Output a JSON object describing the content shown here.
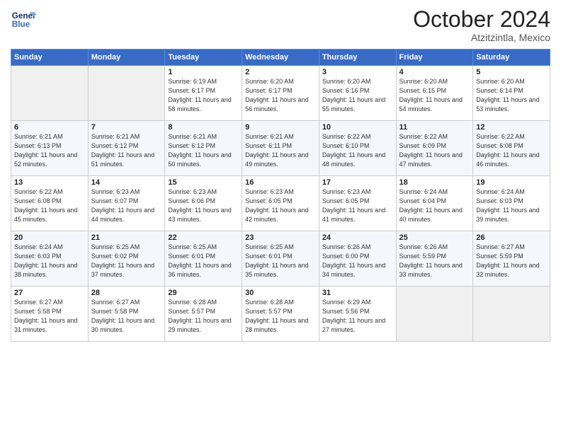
{
  "header": {
    "logo_line1": "General",
    "logo_line2": "Blue",
    "month": "October 2024",
    "location": "Atzitzintla, Mexico"
  },
  "days_of_week": [
    "Sunday",
    "Monday",
    "Tuesday",
    "Wednesday",
    "Thursday",
    "Friday",
    "Saturday"
  ],
  "weeks": [
    [
      {
        "day": "",
        "info": ""
      },
      {
        "day": "",
        "info": ""
      },
      {
        "day": "1",
        "info": "Sunrise: 6:19 AM\nSunset: 6:17 PM\nDaylight: 11 hours and 58 minutes."
      },
      {
        "day": "2",
        "info": "Sunrise: 6:20 AM\nSunset: 6:17 PM\nDaylight: 11 hours and 56 minutes."
      },
      {
        "day": "3",
        "info": "Sunrise: 6:20 AM\nSunset: 6:16 PM\nDaylight: 11 hours and 55 minutes."
      },
      {
        "day": "4",
        "info": "Sunrise: 6:20 AM\nSunset: 6:15 PM\nDaylight: 11 hours and 54 minutes."
      },
      {
        "day": "5",
        "info": "Sunrise: 6:20 AM\nSunset: 6:14 PM\nDaylight: 11 hours and 53 minutes."
      }
    ],
    [
      {
        "day": "6",
        "info": "Sunrise: 6:21 AM\nSunset: 6:13 PM\nDaylight: 11 hours and 52 minutes."
      },
      {
        "day": "7",
        "info": "Sunrise: 6:21 AM\nSunset: 6:12 PM\nDaylight: 11 hours and 51 minutes."
      },
      {
        "day": "8",
        "info": "Sunrise: 6:21 AM\nSunset: 6:12 PM\nDaylight: 11 hours and 50 minutes."
      },
      {
        "day": "9",
        "info": "Sunrise: 6:21 AM\nSunset: 6:11 PM\nDaylight: 11 hours and 49 minutes."
      },
      {
        "day": "10",
        "info": "Sunrise: 6:22 AM\nSunset: 6:10 PM\nDaylight: 11 hours and 48 minutes."
      },
      {
        "day": "11",
        "info": "Sunrise: 6:22 AM\nSunset: 6:09 PM\nDaylight: 11 hours and 47 minutes."
      },
      {
        "day": "12",
        "info": "Sunrise: 6:22 AM\nSunset: 6:08 PM\nDaylight: 11 hours and 46 minutes."
      }
    ],
    [
      {
        "day": "13",
        "info": "Sunrise: 6:22 AM\nSunset: 6:08 PM\nDaylight: 11 hours and 45 minutes."
      },
      {
        "day": "14",
        "info": "Sunrise: 6:23 AM\nSunset: 6:07 PM\nDaylight: 11 hours and 44 minutes."
      },
      {
        "day": "15",
        "info": "Sunrise: 6:23 AM\nSunset: 6:06 PM\nDaylight: 11 hours and 43 minutes."
      },
      {
        "day": "16",
        "info": "Sunrise: 6:23 AM\nSunset: 6:05 PM\nDaylight: 11 hours and 42 minutes."
      },
      {
        "day": "17",
        "info": "Sunrise: 6:23 AM\nSunset: 6:05 PM\nDaylight: 11 hours and 41 minutes."
      },
      {
        "day": "18",
        "info": "Sunrise: 6:24 AM\nSunset: 6:04 PM\nDaylight: 11 hours and 40 minutes."
      },
      {
        "day": "19",
        "info": "Sunrise: 6:24 AM\nSunset: 6:03 PM\nDaylight: 11 hours and 39 minutes."
      }
    ],
    [
      {
        "day": "20",
        "info": "Sunrise: 6:24 AM\nSunset: 6:03 PM\nDaylight: 11 hours and 38 minutes."
      },
      {
        "day": "21",
        "info": "Sunrise: 6:25 AM\nSunset: 6:02 PM\nDaylight: 11 hours and 37 minutes."
      },
      {
        "day": "22",
        "info": "Sunrise: 6:25 AM\nSunset: 6:01 PM\nDaylight: 11 hours and 36 minutes."
      },
      {
        "day": "23",
        "info": "Sunrise: 6:25 AM\nSunset: 6:01 PM\nDaylight: 11 hours and 35 minutes."
      },
      {
        "day": "24",
        "info": "Sunrise: 6:26 AM\nSunset: 6:00 PM\nDaylight: 11 hours and 34 minutes."
      },
      {
        "day": "25",
        "info": "Sunrise: 6:26 AM\nSunset: 5:59 PM\nDaylight: 11 hours and 33 minutes."
      },
      {
        "day": "26",
        "info": "Sunrise: 6:27 AM\nSunset: 5:59 PM\nDaylight: 11 hours and 32 minutes."
      }
    ],
    [
      {
        "day": "27",
        "info": "Sunrise: 6:27 AM\nSunset: 5:58 PM\nDaylight: 11 hours and 31 minutes."
      },
      {
        "day": "28",
        "info": "Sunrise: 6:27 AM\nSunset: 5:58 PM\nDaylight: 11 hours and 30 minutes."
      },
      {
        "day": "29",
        "info": "Sunrise: 6:28 AM\nSunset: 5:57 PM\nDaylight: 11 hours and 29 minutes."
      },
      {
        "day": "30",
        "info": "Sunrise: 6:28 AM\nSunset: 5:57 PM\nDaylight: 11 hours and 28 minutes."
      },
      {
        "day": "31",
        "info": "Sunrise: 6:29 AM\nSunset: 5:56 PM\nDaylight: 11 hours and 27 minutes."
      },
      {
        "day": "",
        "info": ""
      },
      {
        "day": "",
        "info": ""
      }
    ]
  ]
}
